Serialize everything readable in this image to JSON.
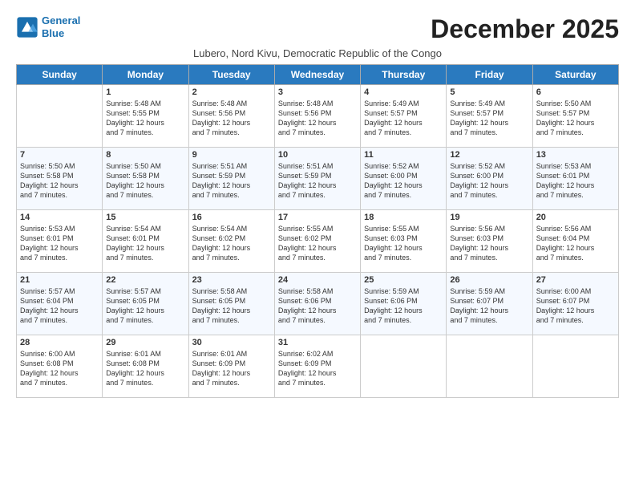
{
  "logo": {
    "line1": "General",
    "line2": "Blue"
  },
  "title": "December 2025",
  "subtitle": "Lubero, Nord Kivu, Democratic Republic of the Congo",
  "days_of_week": [
    "Sunday",
    "Monday",
    "Tuesday",
    "Wednesday",
    "Thursday",
    "Friday",
    "Saturday"
  ],
  "weeks": [
    [
      {
        "day": "",
        "info": ""
      },
      {
        "day": "1",
        "info": "Sunrise: 5:48 AM\nSunset: 5:55 PM\nDaylight: 12 hours\nand 7 minutes."
      },
      {
        "day": "2",
        "info": "Sunrise: 5:48 AM\nSunset: 5:56 PM\nDaylight: 12 hours\nand 7 minutes."
      },
      {
        "day": "3",
        "info": "Sunrise: 5:48 AM\nSunset: 5:56 PM\nDaylight: 12 hours\nand 7 minutes."
      },
      {
        "day": "4",
        "info": "Sunrise: 5:49 AM\nSunset: 5:57 PM\nDaylight: 12 hours\nand 7 minutes."
      },
      {
        "day": "5",
        "info": "Sunrise: 5:49 AM\nSunset: 5:57 PM\nDaylight: 12 hours\nand 7 minutes."
      },
      {
        "day": "6",
        "info": "Sunrise: 5:50 AM\nSunset: 5:57 PM\nDaylight: 12 hours\nand 7 minutes."
      }
    ],
    [
      {
        "day": "7",
        "info": "Sunrise: 5:50 AM\nSunset: 5:58 PM\nDaylight: 12 hours\nand 7 minutes."
      },
      {
        "day": "8",
        "info": "Sunrise: 5:50 AM\nSunset: 5:58 PM\nDaylight: 12 hours\nand 7 minutes."
      },
      {
        "day": "9",
        "info": "Sunrise: 5:51 AM\nSunset: 5:59 PM\nDaylight: 12 hours\nand 7 minutes."
      },
      {
        "day": "10",
        "info": "Sunrise: 5:51 AM\nSunset: 5:59 PM\nDaylight: 12 hours\nand 7 minutes."
      },
      {
        "day": "11",
        "info": "Sunrise: 5:52 AM\nSunset: 6:00 PM\nDaylight: 12 hours\nand 7 minutes."
      },
      {
        "day": "12",
        "info": "Sunrise: 5:52 AM\nSunset: 6:00 PM\nDaylight: 12 hours\nand 7 minutes."
      },
      {
        "day": "13",
        "info": "Sunrise: 5:53 AM\nSunset: 6:01 PM\nDaylight: 12 hours\nand 7 minutes."
      }
    ],
    [
      {
        "day": "14",
        "info": "Sunrise: 5:53 AM\nSunset: 6:01 PM\nDaylight: 12 hours\nand 7 minutes."
      },
      {
        "day": "15",
        "info": "Sunrise: 5:54 AM\nSunset: 6:01 PM\nDaylight: 12 hours\nand 7 minutes."
      },
      {
        "day": "16",
        "info": "Sunrise: 5:54 AM\nSunset: 6:02 PM\nDaylight: 12 hours\nand 7 minutes."
      },
      {
        "day": "17",
        "info": "Sunrise: 5:55 AM\nSunset: 6:02 PM\nDaylight: 12 hours\nand 7 minutes."
      },
      {
        "day": "18",
        "info": "Sunrise: 5:55 AM\nSunset: 6:03 PM\nDaylight: 12 hours\nand 7 minutes."
      },
      {
        "day": "19",
        "info": "Sunrise: 5:56 AM\nSunset: 6:03 PM\nDaylight: 12 hours\nand 7 minutes."
      },
      {
        "day": "20",
        "info": "Sunrise: 5:56 AM\nSunset: 6:04 PM\nDaylight: 12 hours\nand 7 minutes."
      }
    ],
    [
      {
        "day": "21",
        "info": "Sunrise: 5:57 AM\nSunset: 6:04 PM\nDaylight: 12 hours\nand 7 minutes."
      },
      {
        "day": "22",
        "info": "Sunrise: 5:57 AM\nSunset: 6:05 PM\nDaylight: 12 hours\nand 7 minutes."
      },
      {
        "day": "23",
        "info": "Sunrise: 5:58 AM\nSunset: 6:05 PM\nDaylight: 12 hours\nand 7 minutes."
      },
      {
        "day": "24",
        "info": "Sunrise: 5:58 AM\nSunset: 6:06 PM\nDaylight: 12 hours\nand 7 minutes."
      },
      {
        "day": "25",
        "info": "Sunrise: 5:59 AM\nSunset: 6:06 PM\nDaylight: 12 hours\nand 7 minutes."
      },
      {
        "day": "26",
        "info": "Sunrise: 5:59 AM\nSunset: 6:07 PM\nDaylight: 12 hours\nand 7 minutes."
      },
      {
        "day": "27",
        "info": "Sunrise: 6:00 AM\nSunset: 6:07 PM\nDaylight: 12 hours\nand 7 minutes."
      }
    ],
    [
      {
        "day": "28",
        "info": "Sunrise: 6:00 AM\nSunset: 6:08 PM\nDaylight: 12 hours\nand 7 minutes."
      },
      {
        "day": "29",
        "info": "Sunrise: 6:01 AM\nSunset: 6:08 PM\nDaylight: 12 hours\nand 7 minutes."
      },
      {
        "day": "30",
        "info": "Sunrise: 6:01 AM\nSunset: 6:09 PM\nDaylight: 12 hours\nand 7 minutes."
      },
      {
        "day": "31",
        "info": "Sunrise: 6:02 AM\nSunset: 6:09 PM\nDaylight: 12 hours\nand 7 minutes."
      },
      {
        "day": "",
        "info": ""
      },
      {
        "day": "",
        "info": ""
      },
      {
        "day": "",
        "info": ""
      }
    ]
  ]
}
